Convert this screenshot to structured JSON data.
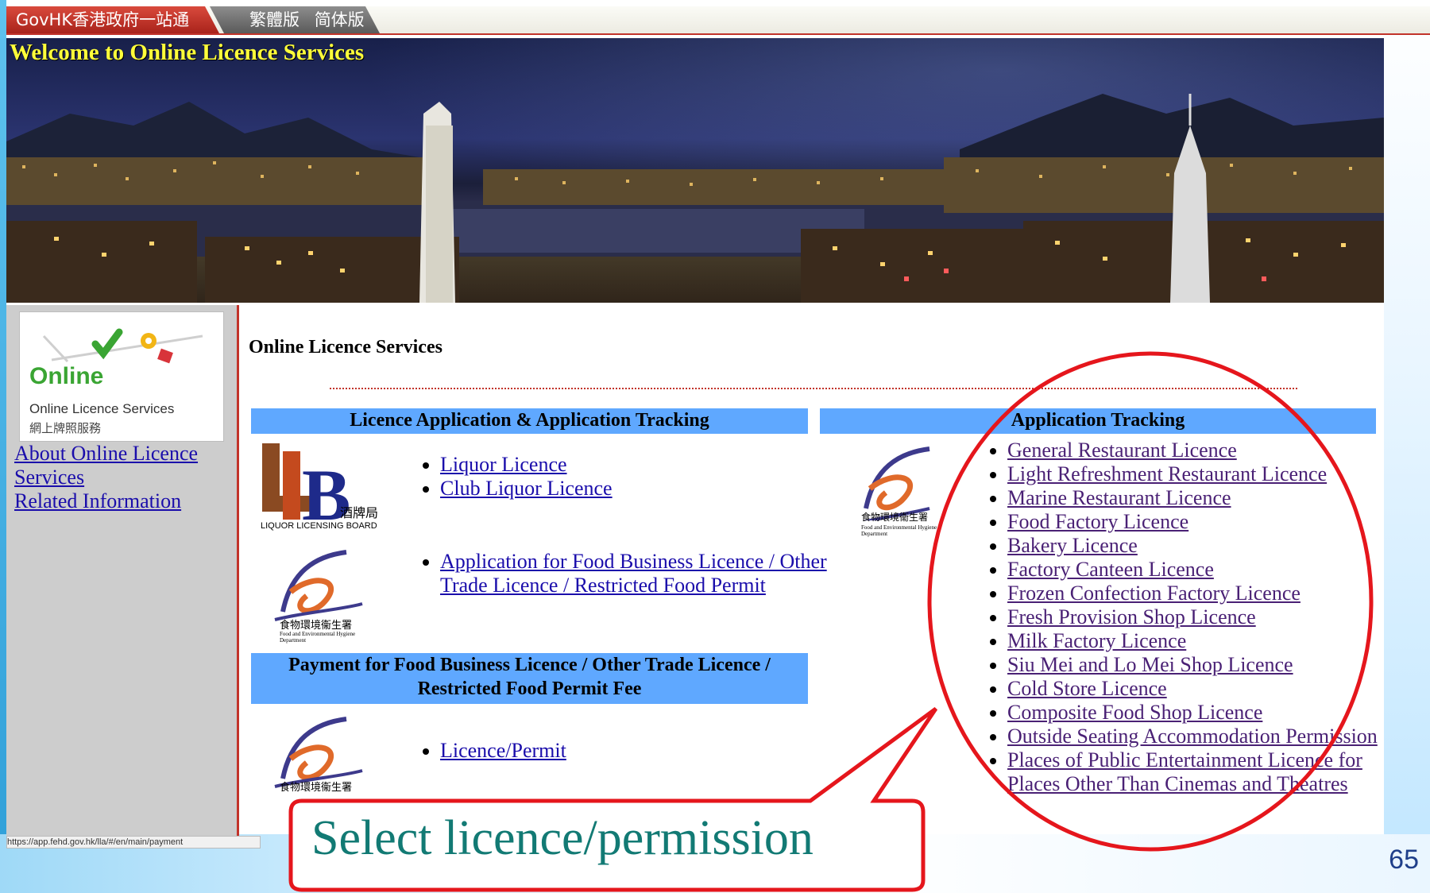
{
  "govbar": {
    "govhk_label": "GovHK香港政府一站通",
    "lang_traditional": "繁體版",
    "lang_simplified": "简体版"
  },
  "banner": {
    "title": "Welcome to Online Licence Services"
  },
  "sidebar": {
    "logo": {
      "title": "Online",
      "subtitle_en": "Online Licence Services",
      "subtitle_zh": "網上牌照服務"
    },
    "links": [
      "About Online Licence Services",
      "Related Information"
    ],
    "status_url": "https://app.fehd.gov.hk/lla/#/en/main/payment"
  },
  "main": {
    "title": "Online Licence Services",
    "section_application": {
      "header": "Licence Application & Application Tracking",
      "liquor_logo": {
        "zh": "酒牌局",
        "en": "LIQUOR LICENSING BOARD"
      },
      "liquor_items": [
        "Liquor Licence",
        "Club Liquor Licence"
      ],
      "food_items": [
        "Application for Food Business Licence / Other Trade Licence / Restricted Food Permit"
      ]
    },
    "section_payment": {
      "header": "Payment for Food Business Licence / Other Trade Licence / Restricted Food Permit Fee",
      "items": [
        "Licence/Permit"
      ]
    },
    "section_tracking": {
      "header": "Application Tracking",
      "items": [
        "General Restaurant Licence",
        "Light Refreshment Restaurant Licence",
        "Marine Restaurant Licence",
        "Food Factory Licence",
        "Bakery Licence",
        "Factory Canteen Licence",
        "Frozen Confection Factory Licence",
        "Fresh Provision Shop Licence",
        "Milk Factory Licence",
        "Siu Mei and Lo Mei Shop Licence",
        "Cold Store Licence",
        "Composite Food Shop Licence",
        "Outside Seating Accommodation Permission",
        "Places of Public Entertainment Licence for Places Other Than Cinemas and Theatres"
      ]
    },
    "fehd_logo": {
      "zh": "食物環境衞生署",
      "en": "Food and Environmental Hygiene Department"
    }
  },
  "annotation": {
    "callout": "Select licence/permission"
  },
  "slide": {
    "page_number": "65"
  },
  "colors": {
    "header_blue": "#5fa8ff",
    "annotation_red": "#e5161c",
    "callout_text": "#127a74",
    "link": "#1a0dab"
  }
}
